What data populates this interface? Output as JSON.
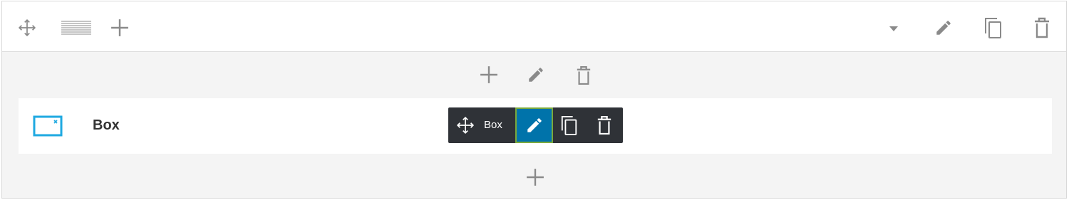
{
  "colors": {
    "icon_gray": "#8a8a8a",
    "toolbar_bg": "#ffffff",
    "row_bg": "#f4f4f4",
    "overlay_bg": "#2f3237",
    "active_blue": "#0073aa",
    "active_border": "#7aa93c",
    "module_icon_blue": "#1fa9e1"
  },
  "toolbar": {
    "icons": [
      "move-icon",
      "columns-layout-icon",
      "add-icon",
      "dropdown-caret-icon",
      "edit-icon",
      "duplicate-icon",
      "delete-icon"
    ]
  },
  "row_tools": {
    "icons": [
      "add-icon",
      "edit-icon",
      "delete-icon"
    ]
  },
  "module": {
    "icon": "box-module-icon",
    "title": "Box"
  },
  "overlay": {
    "label": "Box",
    "icons": [
      "move-icon",
      "edit-icon",
      "duplicate-icon",
      "delete-icon"
    ]
  },
  "bottom": {
    "icon": "add-icon"
  }
}
